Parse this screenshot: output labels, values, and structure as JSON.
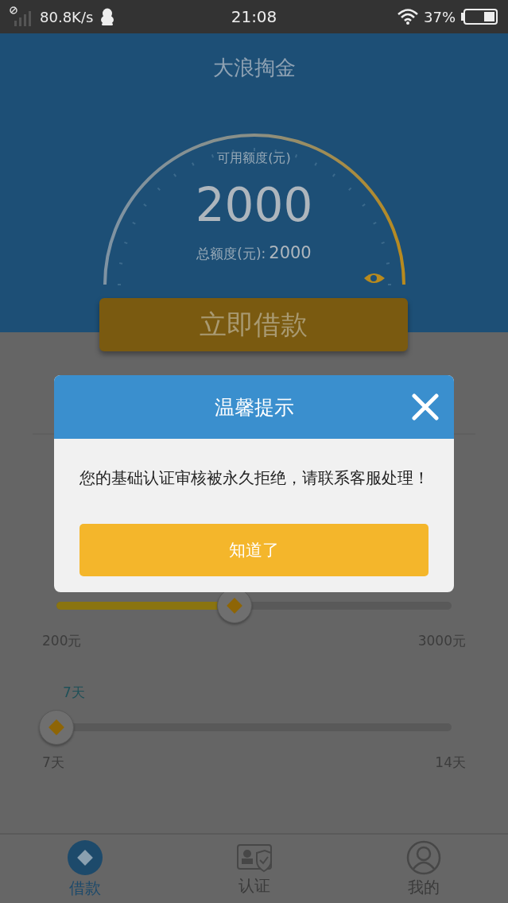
{
  "status_bar": {
    "speed": "80.8K/s",
    "time": "21:08",
    "battery": "37%"
  },
  "header": {
    "title": "大浪掏金",
    "available_label": "可用额度(元)",
    "available_amount": "2000",
    "total_label": "总额度(元):",
    "total_amount": "2000"
  },
  "borrow_button": "立即借款",
  "sliders": [
    {
      "kind": "amount",
      "level": 0.45,
      "min_label": "200元",
      "max_label": "3000元"
    },
    {
      "kind": "days",
      "caption": "7天",
      "level": 0,
      "min_label": "7天",
      "max_label": "14天"
    }
  ],
  "dialog": {
    "title": "温馨提示",
    "message": "您的基础认证审核被永久拒绝，请联系客服处理！",
    "confirm": "知道了"
  },
  "tabs": [
    {
      "kind": "loan",
      "label": "借款",
      "selected": true
    },
    {
      "kind": "verify",
      "label": "认证",
      "selected": false
    },
    {
      "kind": "profile",
      "label": "我的",
      "selected": false
    }
  ]
}
